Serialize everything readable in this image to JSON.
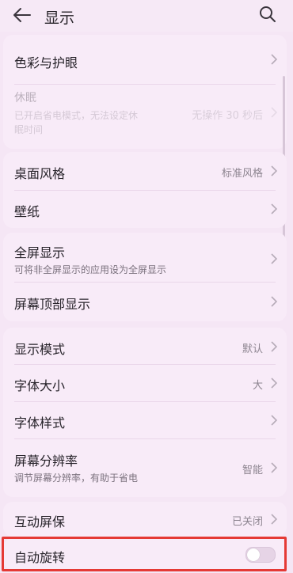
{
  "header": {
    "title": "显示"
  },
  "group1": {
    "color_eye": {
      "label": "色彩与护眼"
    },
    "sleep": {
      "label": "休眠",
      "sub1": "已开启省电模式，无法设定休",
      "sub2": "眠时间",
      "value": "无操作 30 秒后"
    }
  },
  "group2": {
    "desktop_style": {
      "label": "桌面风格",
      "value": "标准风格"
    },
    "wallpaper": {
      "label": "壁纸"
    }
  },
  "group3": {
    "fullscreen": {
      "label": "全屏显示",
      "sub": "可将非全屏显示的应用设为全屏显示"
    },
    "notch": {
      "label": "屏幕顶部显示"
    }
  },
  "group4": {
    "display_mode": {
      "label": "显示模式",
      "value": "默认"
    },
    "font_size": {
      "label": "字体大小",
      "value": "大"
    },
    "font_style": {
      "label": "字体样式"
    },
    "resolution": {
      "label": "屏幕分辨率",
      "sub": "调节屏幕分辨率，有助于省电",
      "value": "智能"
    }
  },
  "group5": {
    "interactive_saver": {
      "label": "互动屏保",
      "value": "已关闭"
    }
  },
  "group6": {
    "auto_rotate": {
      "label": "自动旋转",
      "enabled": false
    }
  },
  "colors": {
    "highlight": "#e53935",
    "background": "#f5e6f5"
  }
}
